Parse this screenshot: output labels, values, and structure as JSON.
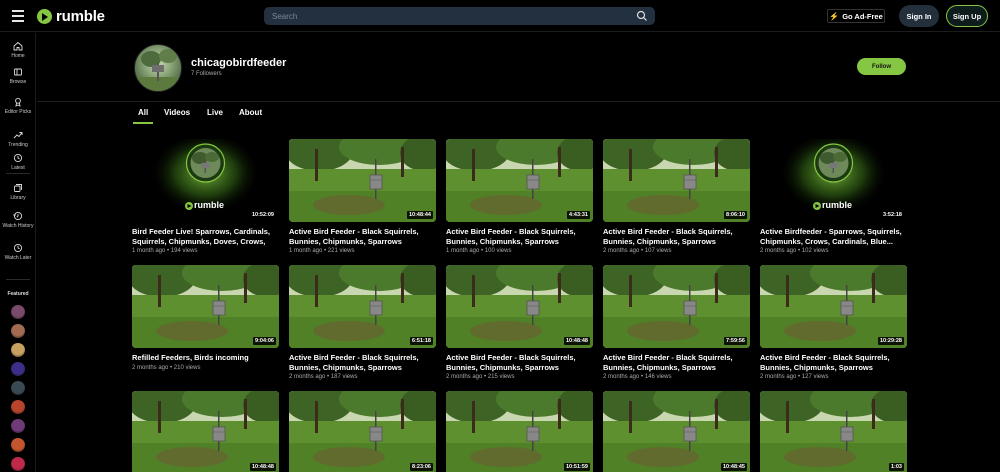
{
  "app": {
    "logo_text": "rumble"
  },
  "search": {
    "placeholder": "Search"
  },
  "header": {
    "ad_free": "Go Ad-Free",
    "sign_in": "Sign In",
    "sign_up": "Sign Up"
  },
  "sidebar": {
    "items": [
      {
        "label": "Home",
        "icon": "home-icon"
      },
      {
        "label": "Browse",
        "icon": "browse-icon"
      },
      {
        "label": "Editor Picks",
        "icon": "award-icon"
      },
      {
        "label": "Trending",
        "icon": "trending-icon"
      },
      {
        "label": "Latest",
        "icon": "clock-icon"
      },
      {
        "label": "Library",
        "icon": "library-icon"
      },
      {
        "label": "Watch History",
        "icon": "history-icon"
      },
      {
        "label": "Watch Later",
        "icon": "watch-later-icon"
      }
    ],
    "featured_label": "Featured",
    "featured_colors": [
      "#7a4a6a",
      "#a36a52",
      "#c8a060",
      "#3b2f8a",
      "#3a4a55",
      "#b8442e",
      "#6e3b78",
      "#c4562f",
      "#c02a4a"
    ]
  },
  "channel": {
    "name": "chicagobirdfeeder",
    "followers": "7 Followers",
    "follow_label": "Follow"
  },
  "tabs": [
    "All",
    "Videos",
    "Live",
    "About"
  ],
  "videos": [
    {
      "title": "Bird Feeder Live! Sparrows, Cardinals, Squirrels, Chipmunks, Doves, Crows,",
      "meta": "1 month ago • 194 views",
      "duration": "10:52:09",
      "live": true
    },
    {
      "title": "Active Bird Feeder - Black Squirrels, Bunnies, Chipmunks, Sparrows",
      "meta": "1 month ago • 221 views",
      "duration": "10:48:44",
      "live": false
    },
    {
      "title": "Active Bird Feeder - Black Squirrels, Bunnies, Chipmunks, Sparrows",
      "meta": "1 month ago • 100 views",
      "duration": "4:43:31",
      "live": false
    },
    {
      "title": "Active Bird Feeder - Black Squirrels, Bunnies, Chipmunks, Sparrows",
      "meta": "2 months ago • 107 views",
      "duration": "8:06:10",
      "live": false
    },
    {
      "title": "Active Birdfeeder - Sparrows, Squirrels, Chipmunks, Crows, Cardinals, Blue...",
      "meta": "2 months ago • 102 views",
      "duration": "3:52:18",
      "live": true
    },
    {
      "title": "Refilled Feeders, Birds incoming",
      "meta": "2 months ago • 210 views",
      "duration": "9:04:06",
      "live": false
    },
    {
      "title": "Active Bird Feeder - Black Squirrels, Bunnies, Chipmunks, Sparrows",
      "meta": "2 months ago • 187 views",
      "duration": "6:51:18",
      "live": false
    },
    {
      "title": "Active Bird Feeder - Black Squirrels, Bunnies, Chipmunks, Sparrows",
      "meta": "2 months ago • 215 views",
      "duration": "10:48:48",
      "live": false
    },
    {
      "title": "Active Bird Feeder - Black Squirrels, Bunnies, Chipmunks, Sparrows",
      "meta": "2 months ago • 146 views",
      "duration": "7:59:56",
      "live": false
    },
    {
      "title": "Active Bird Feeder - Black Squirrels, Bunnies, Chipmunks, Sparrows",
      "meta": "2 months ago • 127 views",
      "duration": "10:29:28",
      "live": false
    },
    {
      "title": "",
      "meta": "",
      "duration": "10:48:48",
      "live": false
    },
    {
      "title": "",
      "meta": "",
      "duration": "8:23:06",
      "live": false
    },
    {
      "title": "",
      "meta": "",
      "duration": "10:51:59",
      "live": false
    },
    {
      "title": "",
      "meta": "",
      "duration": "10:48:45",
      "live": false
    },
    {
      "title": "",
      "meta": "",
      "duration": "1:03",
      "live": false
    }
  ],
  "colors": {
    "brand": "#85c742",
    "search_bg": "#22303f"
  }
}
